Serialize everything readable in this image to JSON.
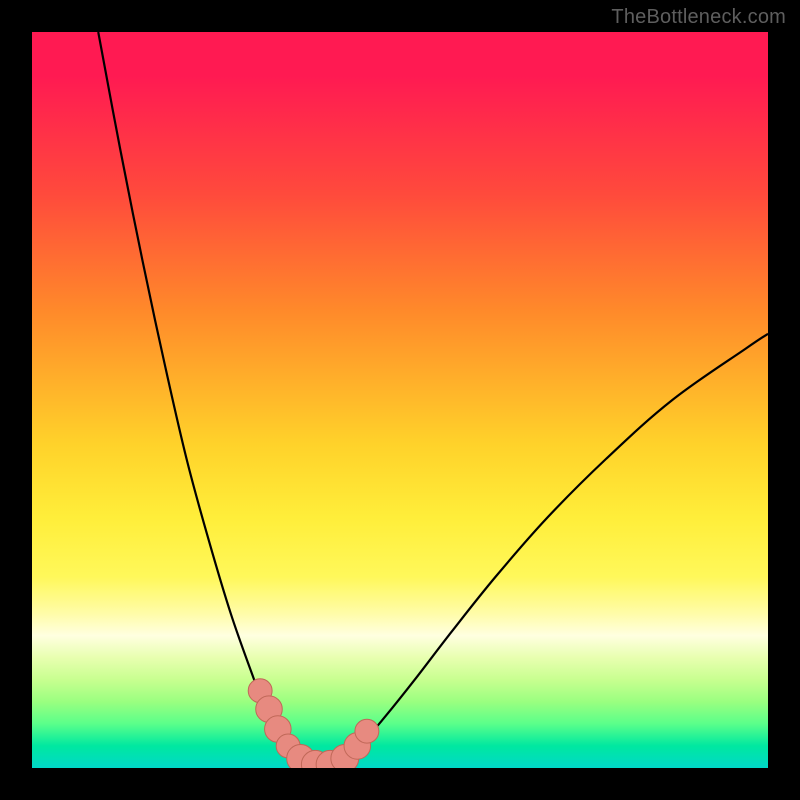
{
  "watermark": "TheBottleneck.com",
  "colors": {
    "background": "#000000",
    "gradient_top": "#ff1a52",
    "gradient_bottom": "#00d8c8",
    "curve_stroke": "#000000",
    "marker_fill": "#e78a80",
    "marker_stroke": "#c06858"
  },
  "chart_data": {
    "type": "line",
    "title": "",
    "xlabel": "",
    "ylabel": "",
    "xlim": [
      0,
      100
    ],
    "ylim": [
      0,
      100
    ],
    "grid": false,
    "legend": false,
    "series": [
      {
        "name": "left-branch",
        "x": [
          9,
          12,
          15,
          18,
          21,
          24,
          27,
          30,
          31.5,
          33,
          34.5,
          36
        ],
        "y": [
          100,
          84,
          69,
          55,
          42,
          31,
          21,
          12.5,
          8.5,
          5.5,
          3,
          1.5
        ]
      },
      {
        "name": "right-branch",
        "x": [
          43,
          45,
          48,
          52,
          57,
          63,
          70,
          78,
          87,
          97,
          100
        ],
        "y": [
          1.5,
          3.5,
          7,
          12,
          18.5,
          26,
          34,
          42,
          50,
          57,
          59
        ]
      },
      {
        "name": "valley-floor",
        "x": [
          36,
          37.5,
          39,
          40.5,
          42,
          43
        ],
        "y": [
          1.5,
          0.6,
          0.3,
          0.3,
          0.6,
          1.5
        ]
      }
    ],
    "markers": [
      {
        "x": 31.0,
        "y": 10.5,
        "r": 1.2
      },
      {
        "x": 32.2,
        "y": 8.0,
        "r": 1.4
      },
      {
        "x": 33.4,
        "y": 5.3,
        "r": 1.4
      },
      {
        "x": 34.8,
        "y": 3.0,
        "r": 1.2
      },
      {
        "x": 36.5,
        "y": 1.3,
        "r": 1.5
      },
      {
        "x": 38.5,
        "y": 0.5,
        "r": 1.5
      },
      {
        "x": 40.5,
        "y": 0.5,
        "r": 1.5
      },
      {
        "x": 42.5,
        "y": 1.3,
        "r": 1.5
      },
      {
        "x": 44.2,
        "y": 3.0,
        "r": 1.4
      },
      {
        "x": 45.5,
        "y": 5.0,
        "r": 1.2
      }
    ]
  }
}
